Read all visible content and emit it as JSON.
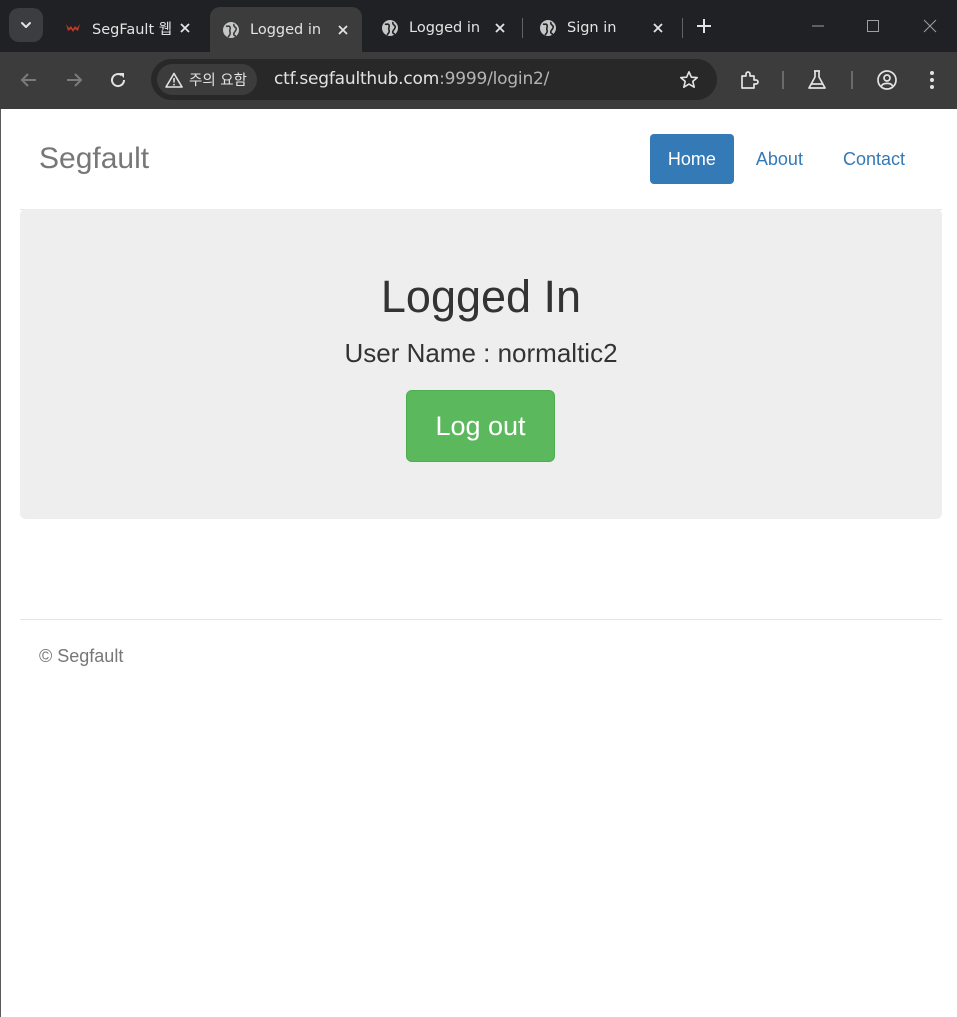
{
  "browser": {
    "tabs": [
      {
        "title": "SegFault 웹",
        "favicon": "segfault-bat-icon",
        "active": false
      },
      {
        "title": "Logged in",
        "favicon": "globe-icon",
        "active": true
      },
      {
        "title": "Logged in",
        "favicon": "globe-icon",
        "active": false
      },
      {
        "title": "Sign in",
        "favicon": "globe-icon",
        "active": false
      }
    ],
    "security_label": "주의 요함",
    "url_host": "ctf.segfaulthub.com",
    "url_path": ":9999/login2/"
  },
  "site": {
    "brand": "Segfault",
    "nav": [
      {
        "label": "Home",
        "active": true
      },
      {
        "label": "About",
        "active": false
      },
      {
        "label": "Contact",
        "active": false
      }
    ]
  },
  "main": {
    "heading": "Logged In",
    "user_line": "User Name : normaltic2",
    "logout_label": "Log out"
  },
  "footer": {
    "text": "© Segfault"
  },
  "colors": {
    "primary": "#337ab7",
    "success": "#5cb85c",
    "jumbotron_bg": "#eeeeee"
  }
}
